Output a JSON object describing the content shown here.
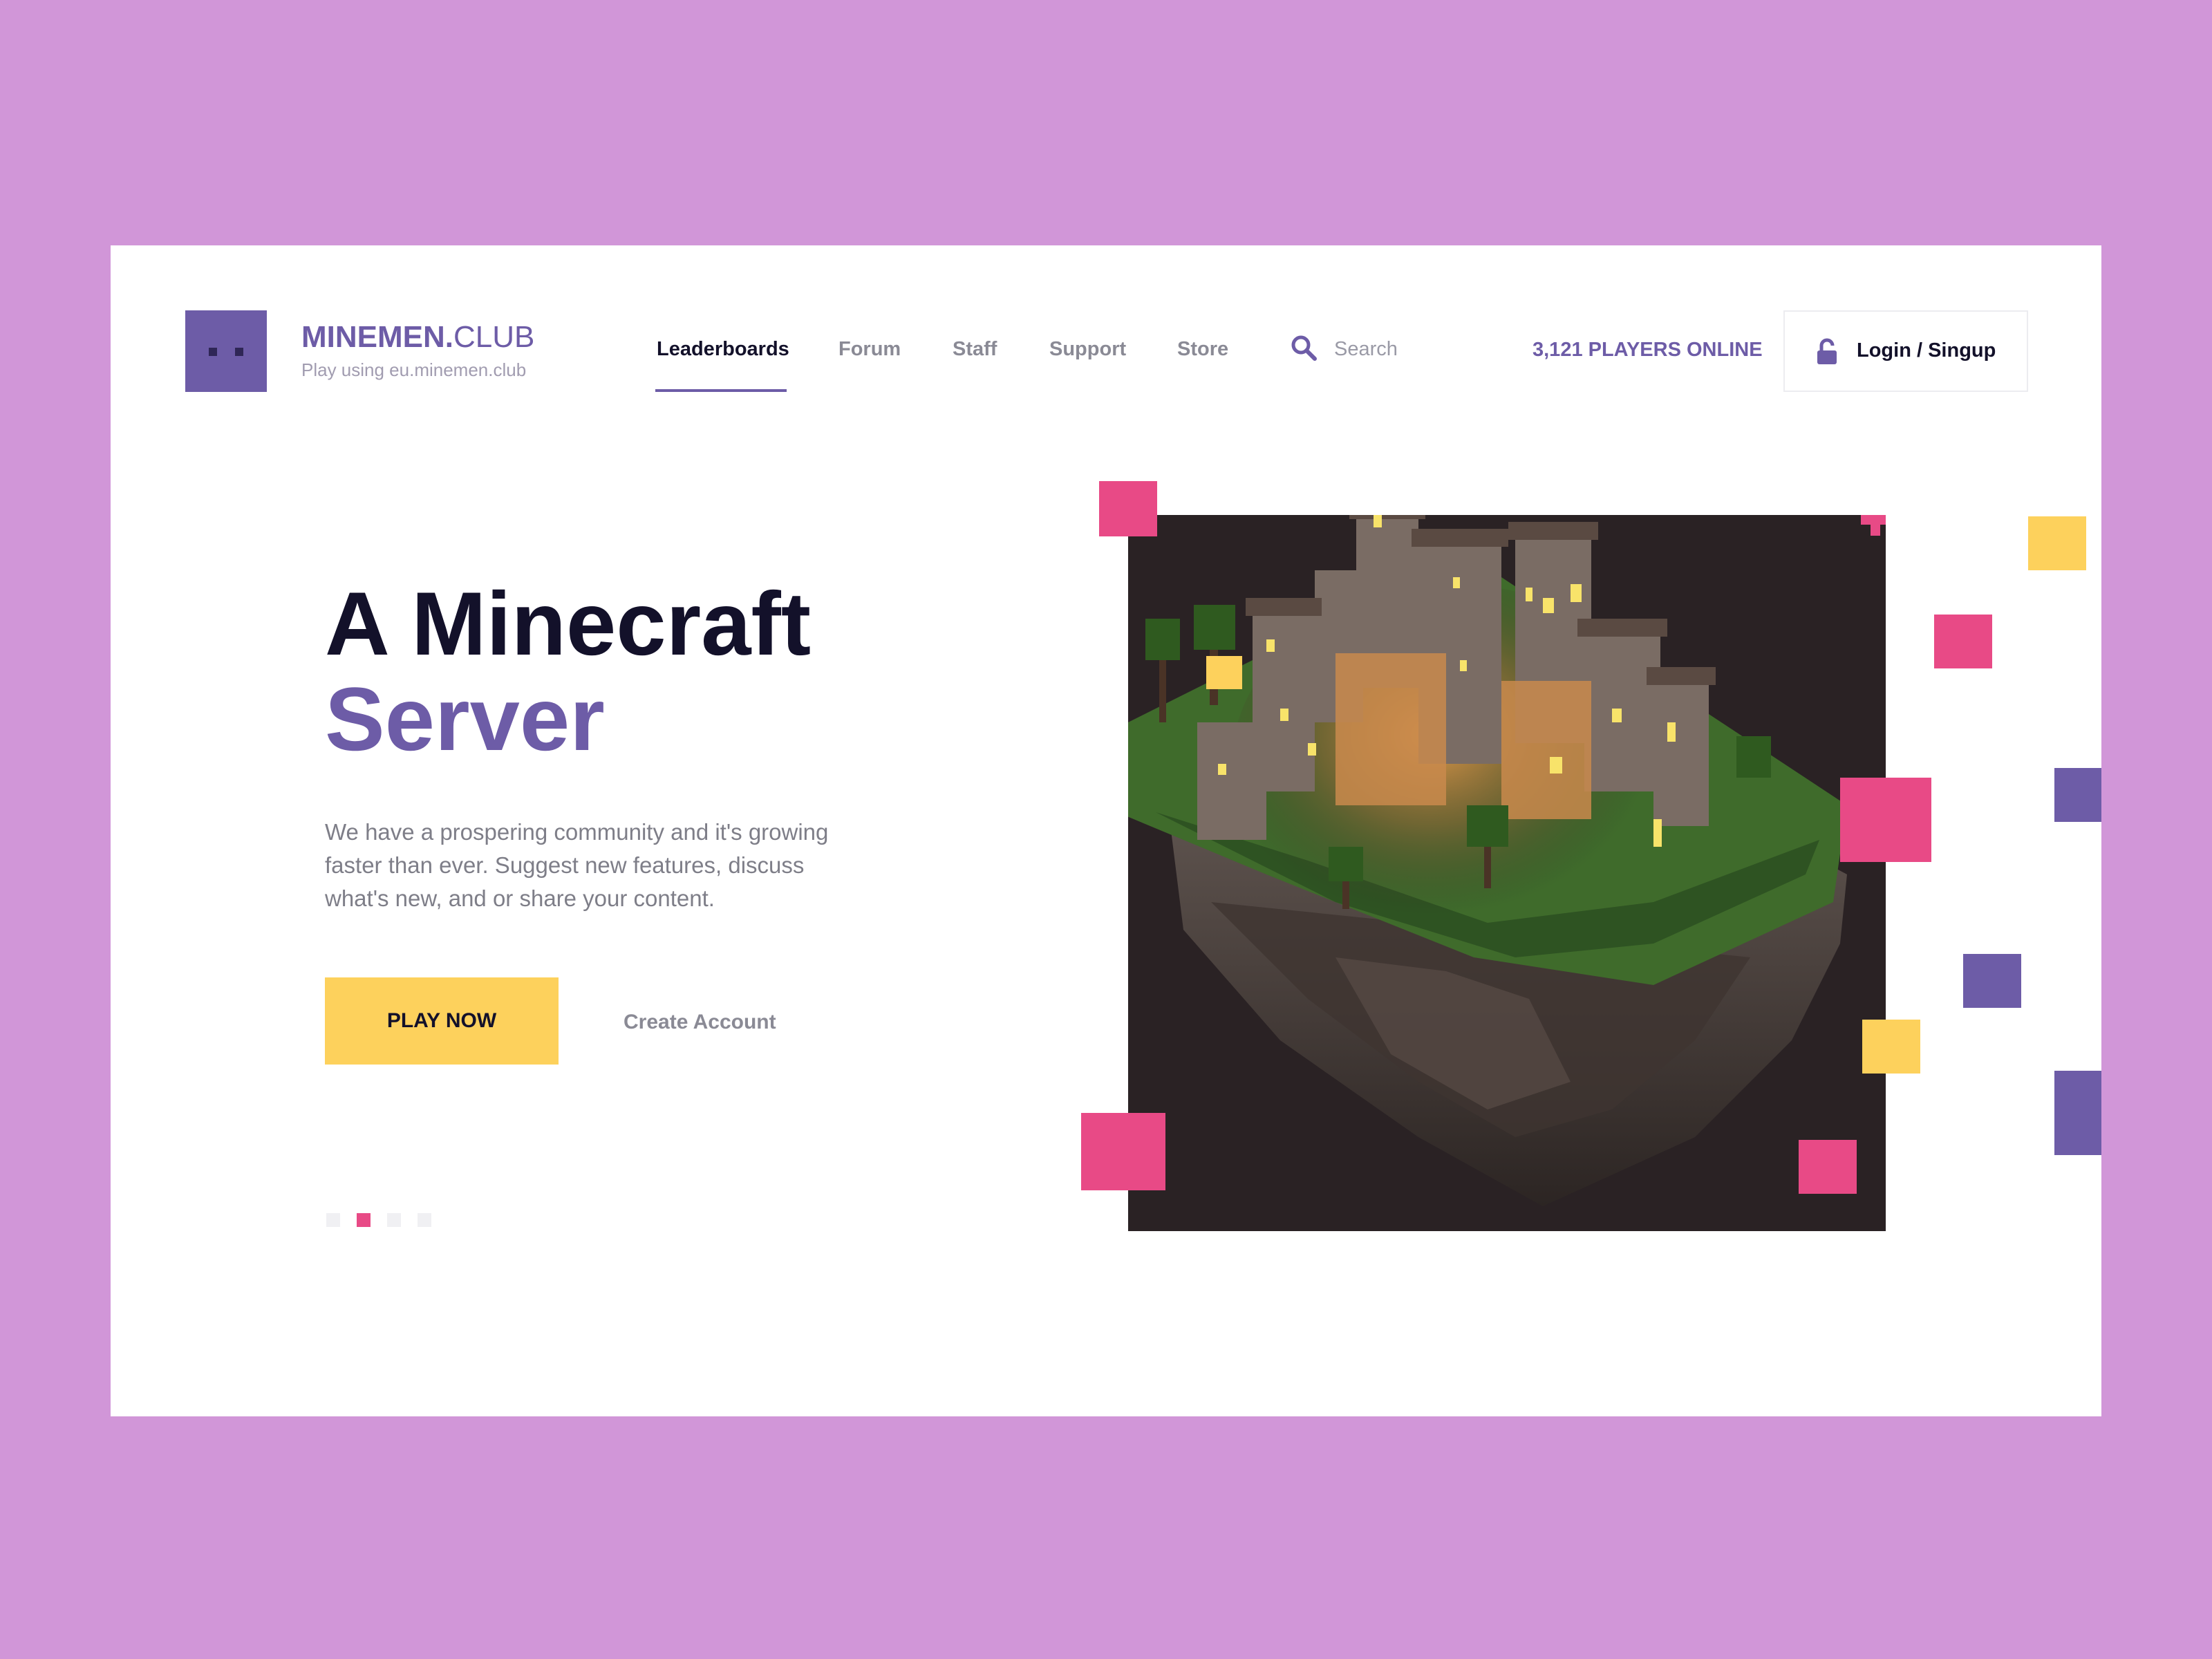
{
  "brand": {
    "name_bold": "MINEMEN.",
    "name_light": "CLUB",
    "subtitle": "Play using eu.minemen.club"
  },
  "nav": {
    "items": [
      {
        "label": "Leaderboards",
        "active": true
      },
      {
        "label": "Forum",
        "active": false
      },
      {
        "label": "Staff",
        "active": false
      },
      {
        "label": "Support",
        "active": false
      },
      {
        "label": "Store",
        "active": false
      }
    ],
    "search_placeholder": "Search"
  },
  "header": {
    "players_online": "3,121 PLAYERS ONLINE",
    "login_label": "Login / Singup"
  },
  "hero": {
    "title_line1": "A Minecraft",
    "title_line2": "Server",
    "description": "We have a prospering community and it's growing faster than ever. Suggest new features, discuss what's new, and or share your content.",
    "primary_button": "PLAY NOW",
    "secondary_link": "Create Account"
  },
  "carousel": {
    "total": 4,
    "active_index": 1
  },
  "colors": {
    "background": "#d196d8",
    "brand_purple": "#6d5ca7",
    "accent_pink": "#e84a86",
    "accent_yellow": "#fdd15c",
    "dark_text": "#13112a"
  },
  "icons": [
    "logo-face-icon",
    "search-icon",
    "lock-icon"
  ]
}
